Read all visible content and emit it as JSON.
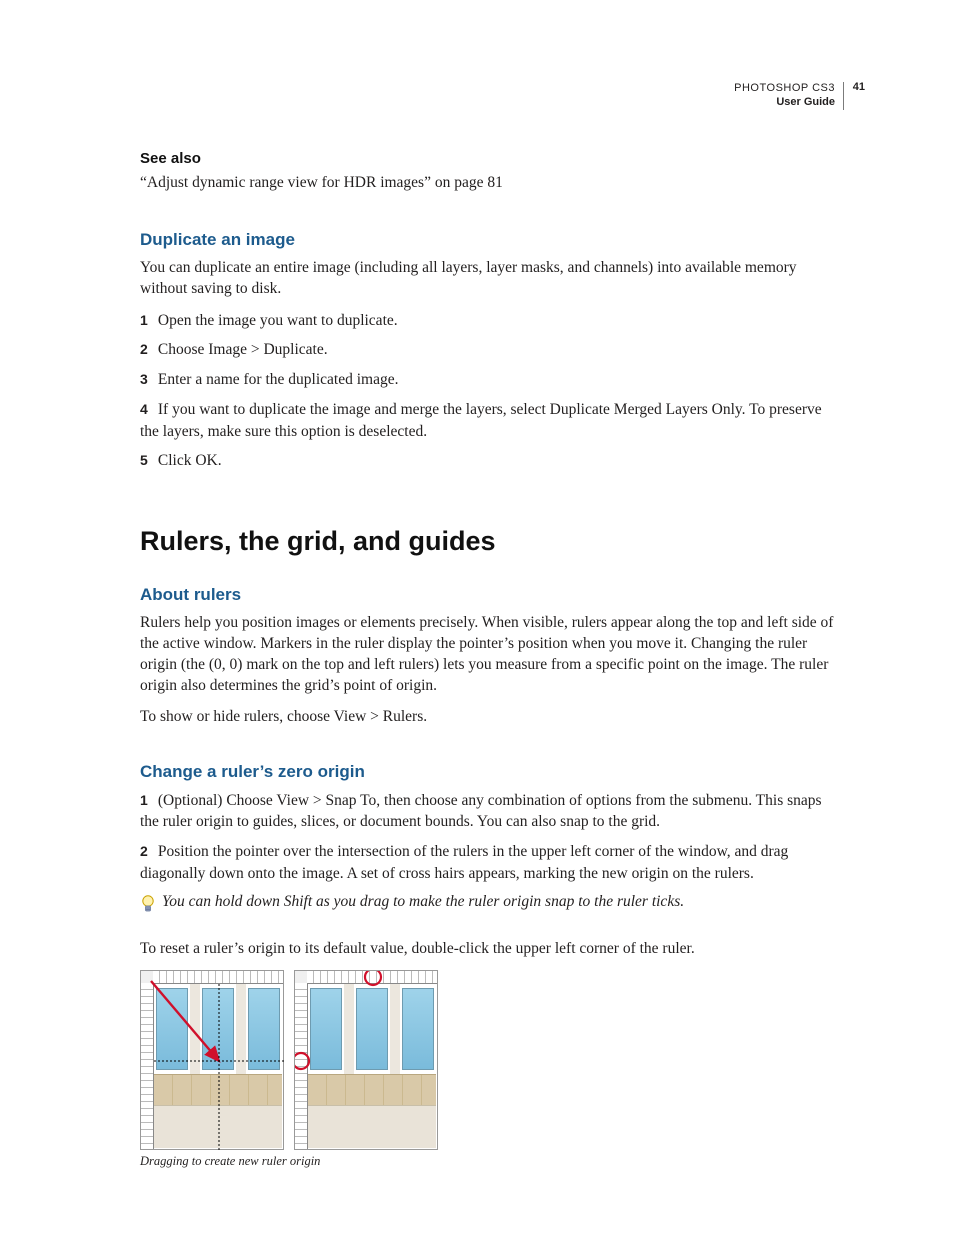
{
  "header": {
    "product": "PHOTOSHOP CS3",
    "subtitle": "User Guide",
    "page_number": "41"
  },
  "see_also": {
    "heading": "See also",
    "link_text": "“Adjust dynamic range view for HDR images” on page 81"
  },
  "duplicate": {
    "heading": "Duplicate an image",
    "intro": "You can duplicate an entire image (including all layers, layer masks, and channels) into available memory without saving to disk.",
    "steps": [
      "Open the image you want to duplicate.",
      "Choose Image > Duplicate.",
      "Enter a name for the duplicated image.",
      "If you want to duplicate the image and merge the layers, select Duplicate Merged Layers Only. To preserve the layers, make sure this option is deselected.",
      "Click OK."
    ]
  },
  "chapter_title": "Rulers, the grid, and guides",
  "about_rulers": {
    "heading": "About rulers",
    "p1": "Rulers help you position images or elements precisely. When visible, rulers appear along the top and left side of the active window. Markers in the ruler display the pointer’s position when you move it. Changing the ruler origin (the (0, 0) mark on the top and left rulers) lets you measure from a specific point on the image. The ruler origin also determines the grid’s point of origin.",
    "p2": "To show or hide rulers, choose View > Rulers."
  },
  "change_origin": {
    "heading": "Change a ruler’s zero origin",
    "step1": "(Optional) Choose View > Snap To, then choose any combination of options from the submenu. This snaps the ruler origin to guides, slices, or document bounds. You can also snap to the grid.",
    "step2": "Position the pointer over the intersection of the rulers in the upper left corner of the window, and drag diagonally down onto the image. A set of cross hairs appears, marking the new origin on the rulers.",
    "tip": "You can hold down Shift as you drag to make the ruler origin snap to the ruler ticks.",
    "reset": "To reset a ruler’s origin to its default value, double-click the upper left corner of the ruler.",
    "caption": "Dragging to create new ruler origin"
  },
  "step_numbers": [
    "1",
    "2",
    "3",
    "4",
    "5"
  ]
}
